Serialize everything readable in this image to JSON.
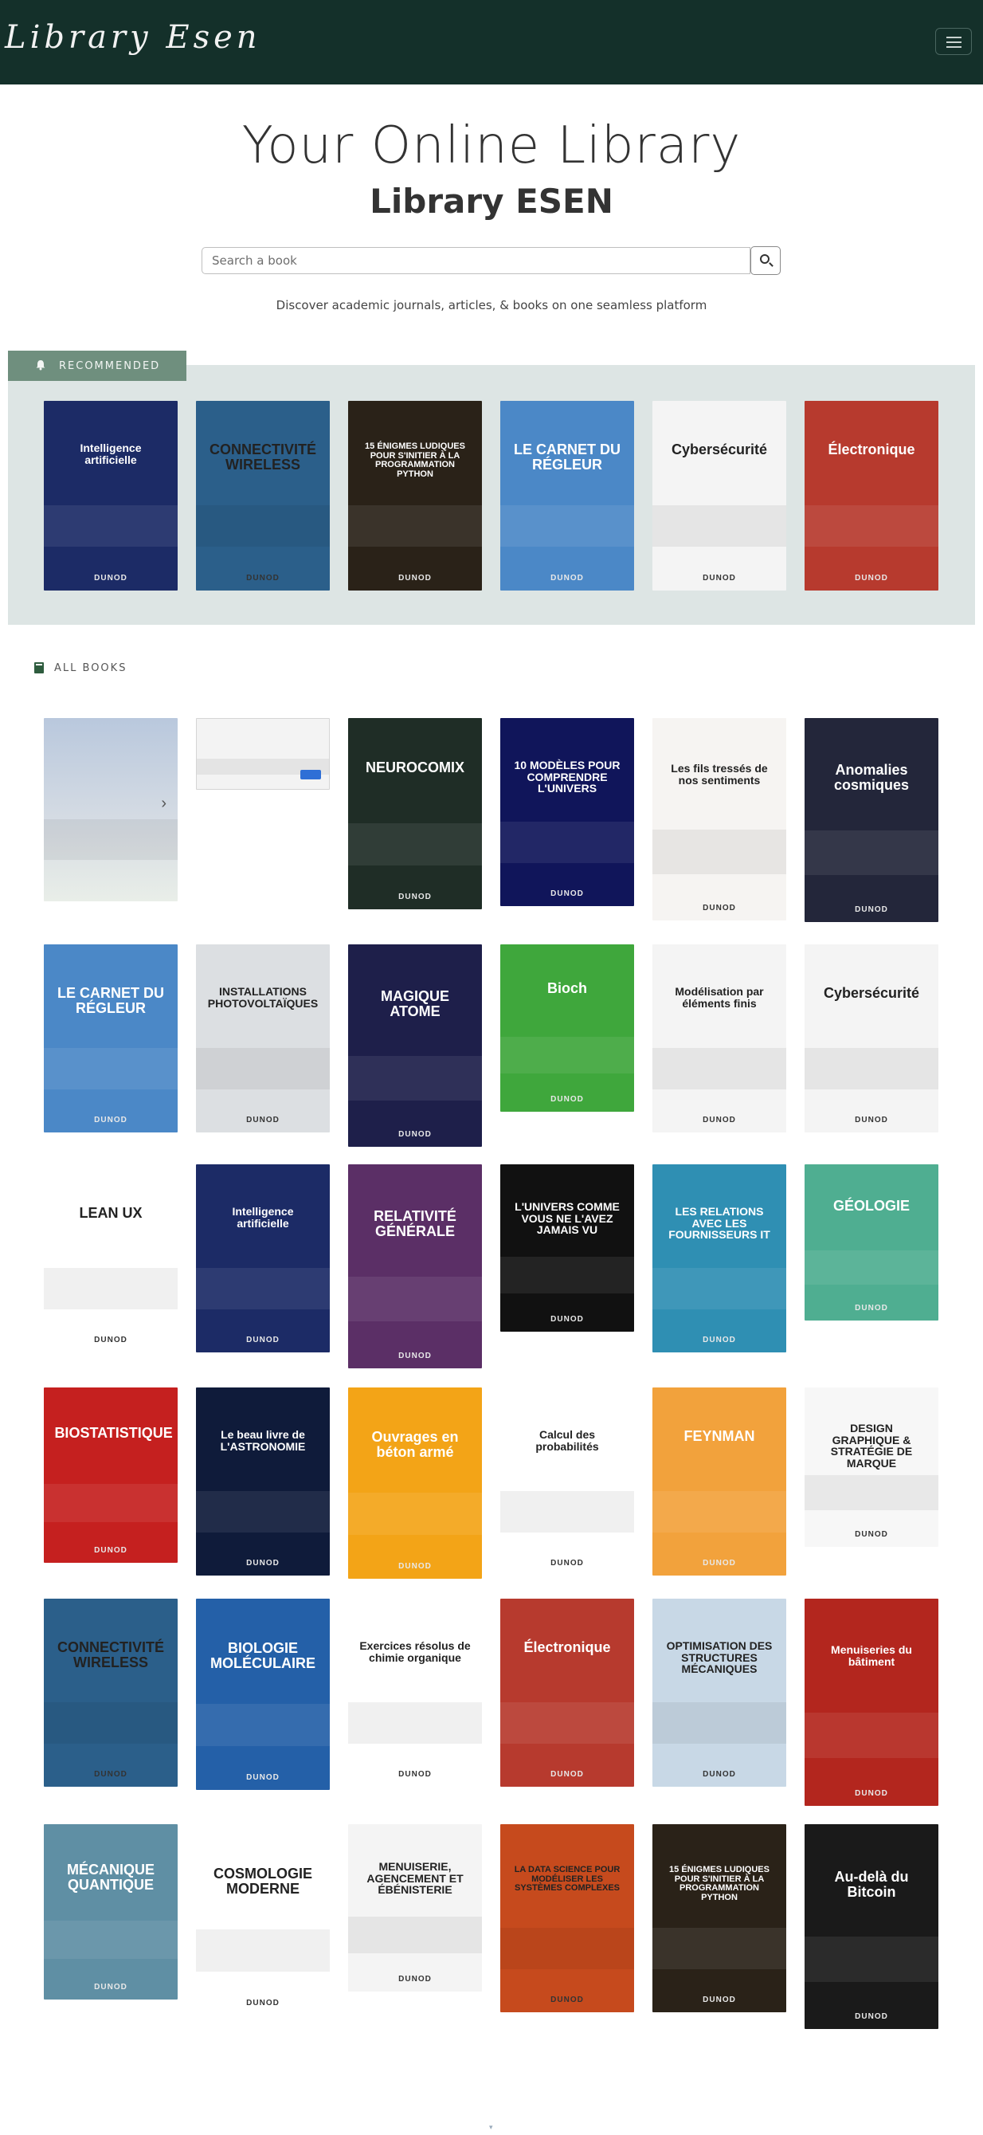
{
  "header": {
    "logo_text": "Library  Esen",
    "menu_icon": "hamburger-menu-icon"
  },
  "hero": {
    "title": "Your Online Library",
    "subtitle": "Library ESEN",
    "search_placeholder": "Search a book",
    "search_icon": "search-icon",
    "tagline": "Discover academic journals, articles, & books on one seamless platform"
  },
  "recommended": {
    "label": "RECOMMENDED",
    "icon": "bell-icon",
    "books": [
      {
        "title": "Intelligence artificielle",
        "bg": "#1c2b66",
        "theme": "dark"
      },
      {
        "title": "CONNECTIVITÉ WIRELESS",
        "bg": "#2b5f8a",
        "theme": "light"
      },
      {
        "title": "15 ÉNIGMES LUDIQUES POUR S'INITIER À LA PROGRAMMATION PYTHON",
        "bg": "#2a2218",
        "theme": "dark"
      },
      {
        "title": "LE CARNET DU RÉGLEUR",
        "bg": "#4b88c7",
        "theme": "dark"
      },
      {
        "title": "Cybersécurité",
        "bg": "#f4f4f4",
        "theme": "light"
      },
      {
        "title": "Électronique",
        "bg": "#b73a2e",
        "theme": "dark"
      }
    ]
  },
  "all_books": {
    "label": "ALL BOOKS",
    "icon": "book-icon",
    "books": [
      {
        "title": "",
        "bg": "#c9ced3",
        "theme": "light"
      },
      {
        "title": "",
        "bg": "#f3f3f3",
        "theme": "light"
      },
      {
        "title": "NEUROCOMIX",
        "bg": "#1f2d26",
        "theme": "dark"
      },
      {
        "title": "10 MODÈLES POUR COMPRENDRE L'UNIVERS",
        "bg": "#10155a",
        "theme": "dark"
      },
      {
        "title": "Les fils tressés de nos sentiments",
        "bg": "#f6f4f2",
        "theme": "light"
      },
      {
        "title": "Anomalies cosmiques",
        "bg": "#23263a",
        "theme": "dark"
      },
      {
        "title": "LE CARNET DU RÉGLEUR",
        "bg": "#4b88c7",
        "theme": "dark"
      },
      {
        "title": "INSTALLATIONS PHOTOVOLTAÏQUES",
        "bg": "#dcdfe2",
        "theme": "light"
      },
      {
        "title": "MAGIQUE ATOME",
        "bg": "#1e1f4a",
        "theme": "dark"
      },
      {
        "title": "Bioch",
        "bg": "#3fa73c",
        "theme": "dark"
      },
      {
        "title": "Modélisation par éléments finis",
        "bg": "#f4f4f4",
        "theme": "light"
      },
      {
        "title": "Cybersécurité",
        "bg": "#f4f4f4",
        "theme": "light"
      },
      {
        "title": "LEAN UX",
        "bg": "#ffffff",
        "theme": "light"
      },
      {
        "title": "Intelligence artificielle",
        "bg": "#1c2b66",
        "theme": "dark"
      },
      {
        "title": "RELATIVITÉ GÉNÉRALE",
        "bg": "#5b2f66",
        "theme": "dark"
      },
      {
        "title": "L'UNIVERS COMME VOUS NE L'AVEZ JAMAIS VU",
        "bg": "#111111",
        "theme": "dark"
      },
      {
        "title": "LES RELATIONS AVEC LES FOURNISSEURS IT",
        "bg": "#2f8fb3",
        "theme": "dark"
      },
      {
        "title": "GÉOLOGIE",
        "bg": "#4fae91",
        "theme": "dark"
      },
      {
        "title": "BIOSTATISTIQUE",
        "bg": "#c5201f",
        "theme": "dark"
      },
      {
        "title": "Le beau livre de L'ASTRONOMIE",
        "bg": "#0f1b3a",
        "theme": "dark"
      },
      {
        "title": "Ouvrages en béton armé",
        "bg": "#f3a417",
        "theme": "dark"
      },
      {
        "title": "Calcul des probabilités",
        "bg": "#ffffff",
        "theme": "light"
      },
      {
        "title": "FEYNMAN",
        "bg": "#f2a23c",
        "theme": "dark"
      },
      {
        "title": "DESIGN GRAPHIQUE & STRATÉGIE DE MARQUE",
        "bg": "#f7f7f7",
        "theme": "light"
      },
      {
        "title": "CONNECTIVITÉ WIRELESS",
        "bg": "#2b5f8a",
        "theme": "light"
      },
      {
        "title": "BIOLOGIE MOLÉCULAIRE",
        "bg": "#2460a8",
        "theme": "dark"
      },
      {
        "title": "Exercices résolus de chimie organique",
        "bg": "#ffffff",
        "theme": "light"
      },
      {
        "title": "Électronique",
        "bg": "#b73a2e",
        "theme": "dark"
      },
      {
        "title": "OPTIMISATION DES STRUCTURES MÉCANIQUES",
        "bg": "#c8d8e6",
        "theme": "light"
      },
      {
        "title": "Menuiseries du bâtiment",
        "bg": "#b3261e",
        "theme": "dark"
      },
      {
        "title": "MÉCANIQUE QUANTIQUE",
        "bg": "#5f8fa4",
        "theme": "dark"
      },
      {
        "title": "COSMOLOGIE MODERNE",
        "bg": "#ffffff",
        "theme": "light"
      },
      {
        "title": "MENUISERIE, AGENCEMENT ET ÉBÉNISTERIE",
        "bg": "#f4f4f4",
        "theme": "light"
      },
      {
        "title": "LA DATA SCIENCE POUR MODÉLISER LES SYSTÈMES COMPLEXES",
        "bg": "#c64a1d",
        "theme": "light"
      },
      {
        "title": "15 ÉNIGMES LUDIQUES POUR S'INITIER À LA PROGRAMMATION PYTHON",
        "bg": "#2a2218",
        "theme": "dark"
      },
      {
        "title": "Au-delà du Bitcoin",
        "bg": "#1a1a1a",
        "theme": "dark"
      }
    ]
  },
  "publisher": "DUNOD",
  "colors": {
    "header": "#14302a",
    "recommended_panel": "#dde5e4",
    "recommended_tab": "#6f8f7e"
  }
}
